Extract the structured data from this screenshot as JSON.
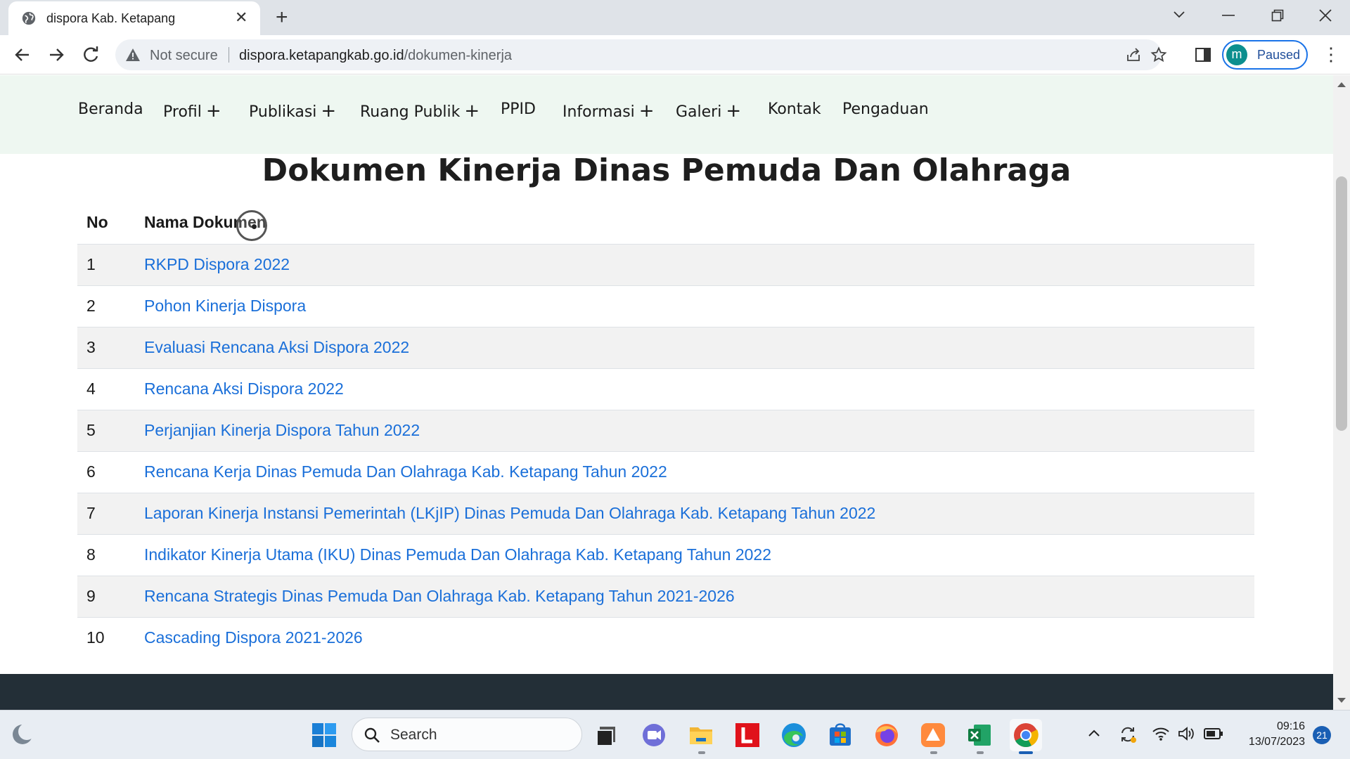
{
  "browser": {
    "tab_title": "dispora Kab. Ketapang",
    "security_label": "Not secure",
    "url_host": "dispora.ketapangkab.go.id",
    "url_path": "/dokumen-kinerja",
    "profile_initial": "m",
    "profile_status": "Paused"
  },
  "nav": {
    "items": [
      {
        "label": "Beranda",
        "has_submenu": false
      },
      {
        "label": "Profil",
        "has_submenu": true
      },
      {
        "label": "Publikasi",
        "has_submenu": true
      },
      {
        "label": "Ruang Publik",
        "has_submenu": true
      },
      {
        "label": "PPID",
        "has_submenu": false
      },
      {
        "label": "Informasi",
        "has_submenu": true
      },
      {
        "label": "Galeri",
        "has_submenu": true
      },
      {
        "label": "Kontak",
        "has_submenu": false
      },
      {
        "label": "Pengaduan",
        "has_submenu": false
      }
    ],
    "plus_symbol": "+"
  },
  "page": {
    "title": "Dokumen Kinerja Dinas Pemuda Dan Olahraga",
    "table": {
      "headers": [
        "No",
        "Nama Dokumen"
      ],
      "rows": [
        {
          "no": "1",
          "name": "RKPD Dispora 2022"
        },
        {
          "no": "2",
          "name": "Pohon Kinerja Dispora"
        },
        {
          "no": "3",
          "name": "Evaluasi Rencana Aksi Dispora 2022"
        },
        {
          "no": "4",
          "name": "Rencana Aksi Dispora 2022"
        },
        {
          "no": "5",
          "name": "Perjanjian Kinerja Dispora Tahun 2022"
        },
        {
          "no": "6",
          "name": "Rencana Kerja Dinas Pemuda Dan Olahraga Kab. Ketapang Tahun 2022"
        },
        {
          "no": "7",
          "name": "Laporan Kinerja Instansi Pemerintah (LKjIP) Dinas Pemuda Dan Olahraga Kab. Ketapang Tahun 2022"
        },
        {
          "no": "8",
          "name": "Indikator Kinerja Utama (IKU) Dinas Pemuda Dan Olahraga Kab. Ketapang Tahun 2022"
        },
        {
          "no": "9",
          "name": "Rencana Strategis Dinas Pemuda Dan Olahraga Kab. Ketapang Tahun 2021-2026"
        },
        {
          "no": "10",
          "name": "Cascading Dispora 2021-2026"
        }
      ]
    }
  },
  "taskbar": {
    "search_label": "Search",
    "time": "09:16",
    "date": "13/07/2023",
    "notification_count": "21"
  },
  "colors": {
    "link": "#1a6fd9",
    "nav_background": "#eef7f1",
    "footer": "#232f37"
  }
}
